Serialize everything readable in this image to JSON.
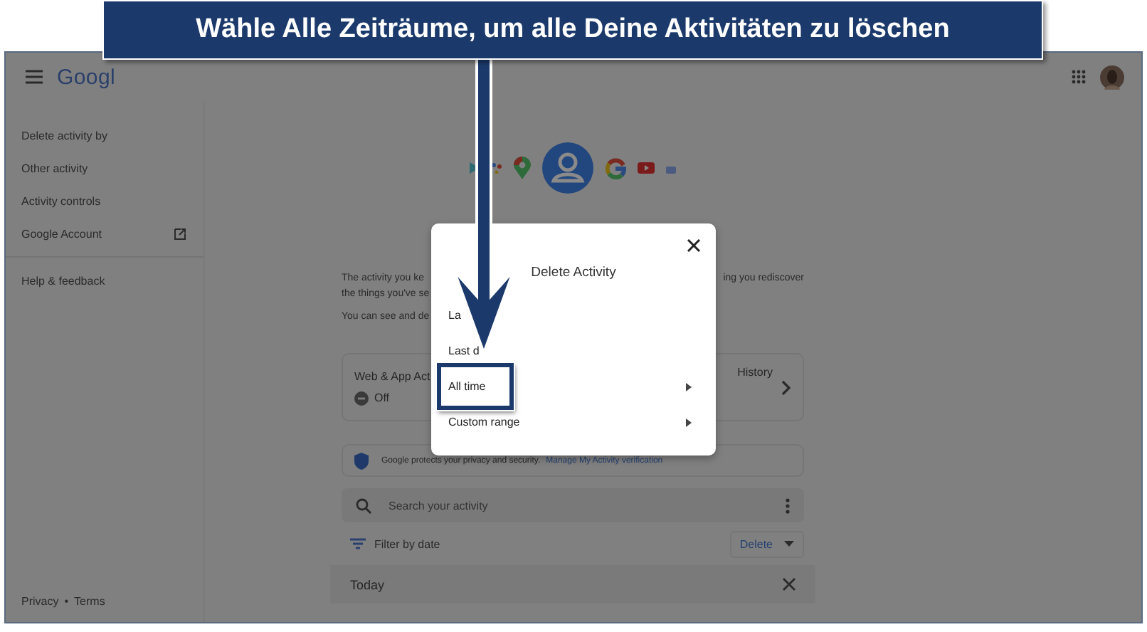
{
  "callout": {
    "text": "Wähle Alle Zeiträume, um alle Deine Aktivitäten zu löschen"
  },
  "header": {
    "logo": "Googl"
  },
  "sidebar": {
    "items": [
      {
        "label": "Delete activity by",
        "external": false
      },
      {
        "label": "Other activity",
        "external": false
      },
      {
        "label": "Activity controls",
        "external": false
      },
      {
        "label": "Google Account",
        "external": true
      }
    ],
    "secondary": [
      {
        "label": "Help & feedback"
      }
    ],
    "footer": {
      "links": [
        "Privacy",
        "Terms"
      ],
      "separator": "•"
    }
  },
  "intro": [
    {
      "left": "The activity you ke",
      "right": "ing you rediscover"
    },
    {
      "left": "the things you've se"
    },
    {
      "left": "You can see and de"
    }
  ],
  "controls": [
    {
      "title": "Web & App Act",
      "status": "Off"
    },
    {
      "title": "History"
    }
  ],
  "privacy": {
    "text": "Google protects your privacy and security.",
    "link": "Manage My Activity verification"
  },
  "search": {
    "placeholder": "Search your activity"
  },
  "filter": {
    "label": "Filter by date"
  },
  "delete_button": {
    "label": "Delete"
  },
  "day": {
    "heading": "Today"
  },
  "dialog": {
    "title": "Delete Activity",
    "options": [
      {
        "label": "La",
        "submenu": false,
        "highlighted": false
      },
      {
        "label": "Last d",
        "submenu": false,
        "highlighted": false
      },
      {
        "label": "All time",
        "submenu": true,
        "highlighted": true
      },
      {
        "label": "Custom range",
        "submenu": true,
        "highlighted": false
      }
    ]
  }
}
